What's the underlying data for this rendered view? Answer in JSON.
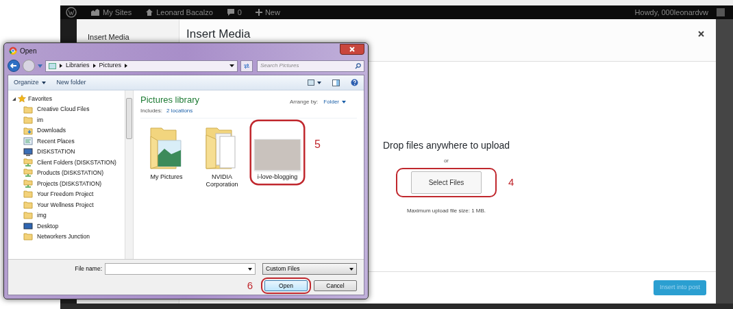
{
  "admin_bar": {
    "items": [
      {
        "kind": "sites",
        "label": "My Sites"
      },
      {
        "kind": "home",
        "label": "Leonard Bacalzo"
      },
      {
        "kind": "comments",
        "label": "0"
      },
      {
        "kind": "new",
        "label": "New"
      }
    ],
    "greeting": "Howdy, 000leonardvw"
  },
  "media_modal": {
    "menu": [
      {
        "label": "Insert Media",
        "selected": true
      }
    ],
    "title": "Insert Media",
    "upload": {
      "heading": "Drop files anywhere to upload",
      "or": "or",
      "button": "Select Files",
      "step": "4",
      "note": "Maximum upload file size: 1 MB."
    },
    "insert_button": "Insert into post"
  },
  "open_dialog": {
    "title": "Open",
    "breadcrumb": [
      "Libraries",
      "Pictures"
    ],
    "search_placeholder": "Search Pictures",
    "toolbar": {
      "organize": "Organize",
      "new_folder": "New folder"
    },
    "nav": {
      "group": "Favorites",
      "expanded": true,
      "items": [
        {
          "kind": "folder",
          "label": "Creative Cloud Files"
        },
        {
          "kind": "folder",
          "label": "im"
        },
        {
          "kind": "downloads",
          "label": "Downloads"
        },
        {
          "kind": "recent",
          "label": "Recent Places"
        },
        {
          "kind": "computer",
          "label": "DISKSTATION"
        },
        {
          "kind": "share",
          "label": "Client Folders (DISKSTATION)"
        },
        {
          "kind": "share",
          "label": "Products (DISKSTATION)"
        },
        {
          "kind": "share",
          "label": "Projects (DISKSTATION)"
        },
        {
          "kind": "folder",
          "label": "Your Freedom Project"
        },
        {
          "kind": "folder",
          "label": "Your Wellness Project"
        },
        {
          "kind": "folder",
          "label": "img"
        },
        {
          "kind": "desktop",
          "label": "Desktop"
        },
        {
          "kind": "folder",
          "label": "Networkers Junction"
        }
      ]
    },
    "library": {
      "title": "Pictures library",
      "includes_label": "Includes:",
      "includes_link": "2 locations",
      "arrange_label": "Arrange by:",
      "arrange_value": "Folder"
    },
    "files": [
      {
        "kind": "picture-folder",
        "label": "My Pictures"
      },
      {
        "kind": "folder",
        "label": "NVIDIA Corporation"
      },
      {
        "kind": "photo",
        "label": "i-love-blogging",
        "step": "5"
      }
    ],
    "file_name_label": "File name:",
    "file_type": "Custom Files",
    "open_button": "Open",
    "open_step": "6",
    "cancel_button": "Cancel"
  }
}
